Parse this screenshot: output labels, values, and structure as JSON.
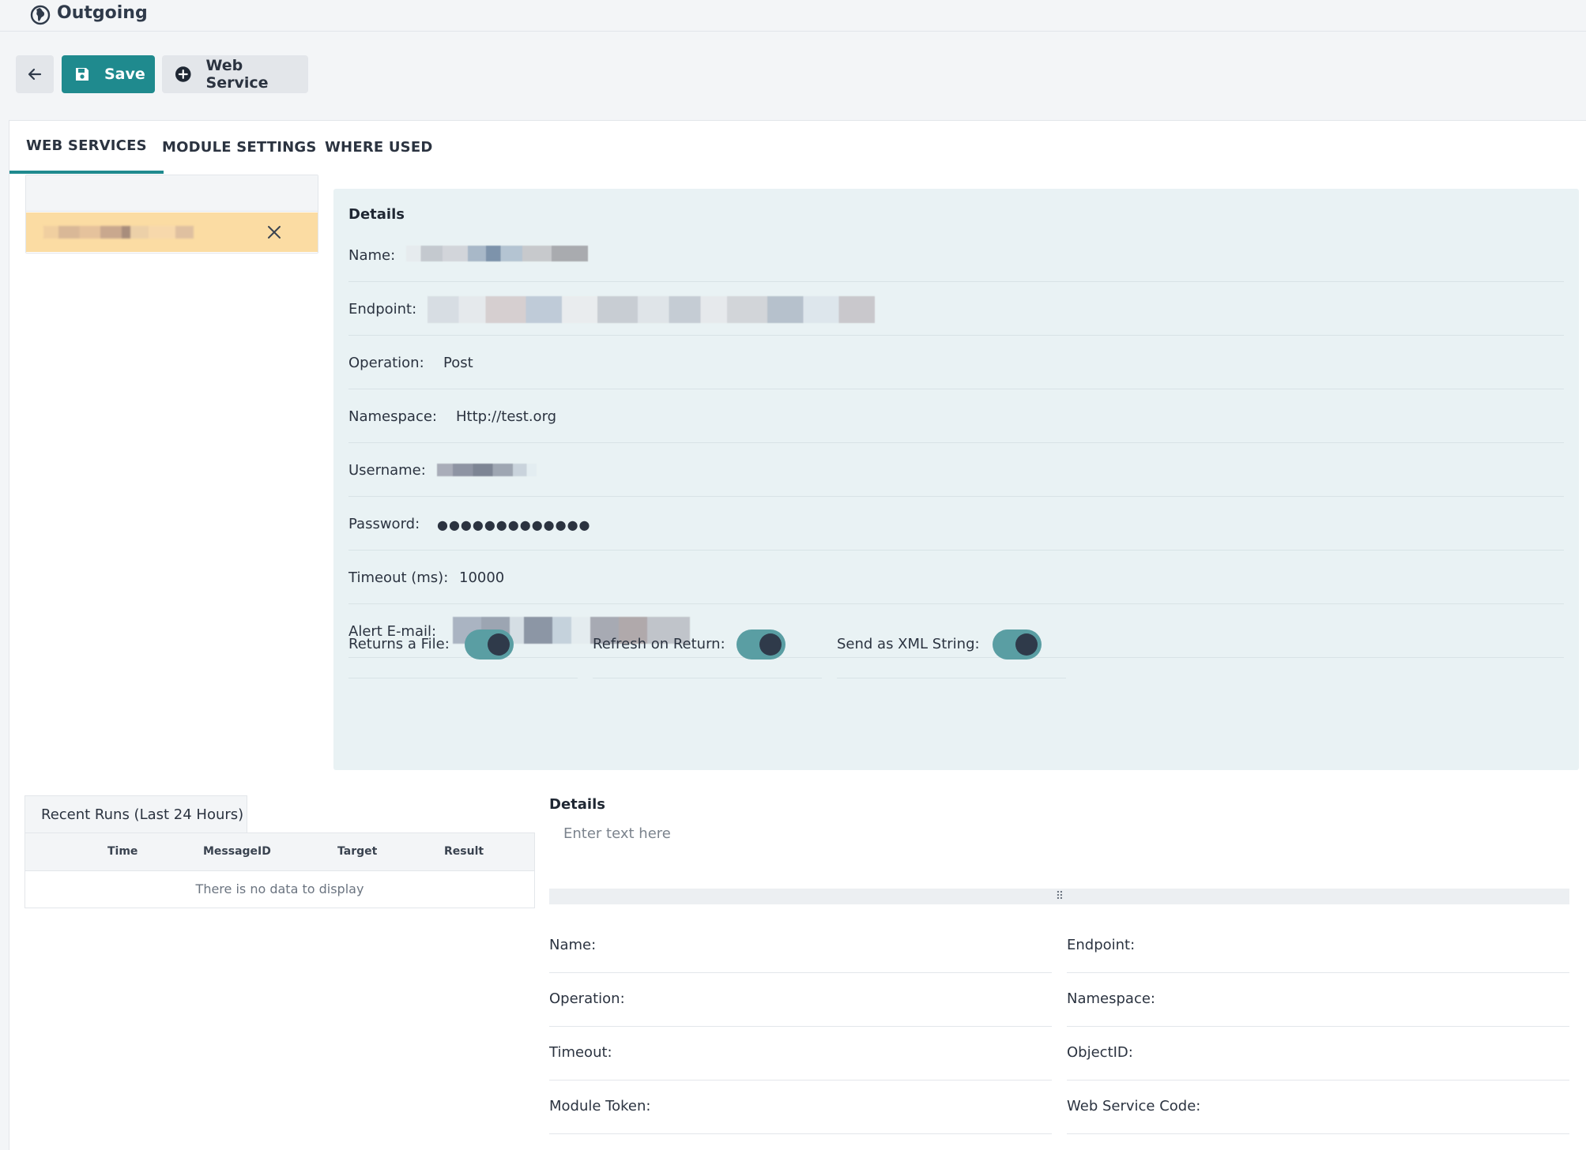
{
  "header": {
    "title": "Outgoing",
    "icon": "globe-icon"
  },
  "toolbar": {
    "back_icon": "arrow-left-icon",
    "save_label": "Save",
    "save_icon": "floppy-disk-icon",
    "web_service_label": "Web Service",
    "web_service_icon": "plus-circle-icon"
  },
  "tabs": [
    {
      "label": "WEB SERVICES",
      "active": true
    },
    {
      "label": "MODULE SETTINGS",
      "active": false
    },
    {
      "label": "WHERE USED",
      "active": false
    }
  ],
  "ws_list": {
    "selected_item_icon": "close-icon"
  },
  "details": {
    "heading": "Details",
    "fields": {
      "name_label": "Name:",
      "endpoint_label": "Endpoint:",
      "operation_label": "Operation:",
      "operation_value": "Post",
      "namespace_label": "Namespace:",
      "namespace_value": "Http://test.org",
      "username_label": "Username:",
      "password_label": "Password:",
      "password_value": "●●●●●●●●●●●●●",
      "timeout_label": "Timeout (ms):",
      "timeout_value": "10000",
      "alert_email_label": "Alert E-mail:"
    },
    "toggles": [
      {
        "label": "Returns a File:",
        "on": true
      },
      {
        "label": "Refresh on Return:",
        "on": true
      },
      {
        "label": "Send as XML String:",
        "on": true
      }
    ]
  },
  "recent_runs": {
    "tab_label": "Recent Runs (Last 24 Hours)",
    "columns": [
      "Time",
      "MessageID",
      "Target",
      "Result"
    ],
    "empty_text": "There is no data to display"
  },
  "bottom_details": {
    "title": "Details",
    "placeholder": "Enter text here",
    "fields": [
      "Name:",
      "Endpoint:",
      "Operation:",
      "Namespace:",
      "Timeout:",
      "ObjectID:",
      "Module Token:",
      "Web Service Code:"
    ]
  },
  "colors": {
    "accent": "#1f8a8e",
    "selected_row": "#fbdca3",
    "details_bg": "#e9f2f4",
    "toggle_track": "#5a9ea3",
    "toggle_knob": "#2f3a4a"
  }
}
